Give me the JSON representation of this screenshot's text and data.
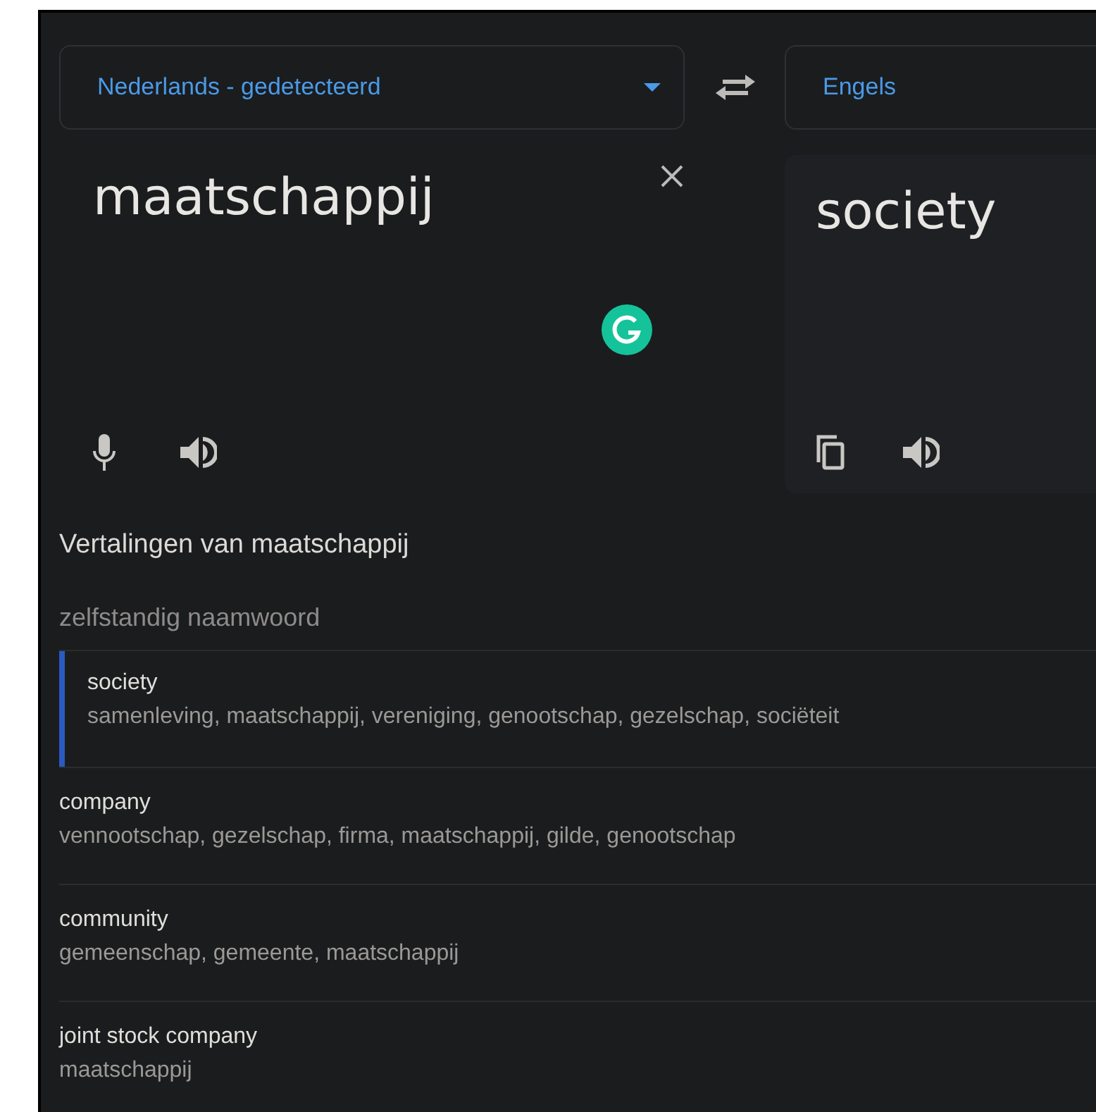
{
  "source_language": {
    "label": "Nederlands - gedetecteerd"
  },
  "target_language": {
    "label": "Engels"
  },
  "source_text": "maatschappij",
  "translated_text": "society",
  "translations": {
    "title": "Vertalingen van maatschappij",
    "part_of_speech": "zelfstandig naamwoord",
    "rows": [
      {
        "word": "society",
        "synonyms": "samenleving, maatschappij, vereniging, genootschap, gezelschap, sociëteit",
        "selected": true
      },
      {
        "word": "company",
        "synonyms": "vennootschap, gezelschap, firma, maatschappij, gilde, genootschap",
        "selected": false
      },
      {
        "word": "community",
        "synonyms": "gemeenschap, gemeente, maatschappij",
        "selected": false
      },
      {
        "word": "joint stock company",
        "synonyms": "maatschappij",
        "selected": false
      }
    ]
  }
}
